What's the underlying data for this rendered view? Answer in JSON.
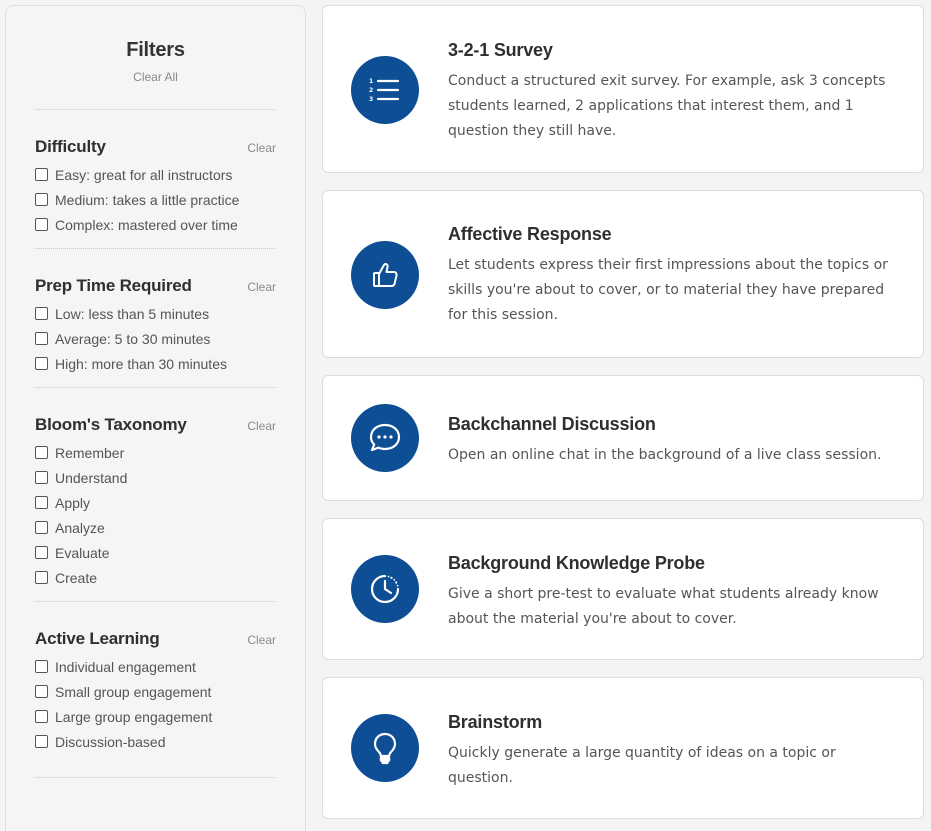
{
  "filters": {
    "title": "Filters",
    "clear_all": "Clear All",
    "groups": [
      {
        "title": "Difficulty",
        "clear": "Clear",
        "options": [
          "Easy: great for all instructors",
          "Medium: takes a little practice",
          "Complex: mastered over time"
        ]
      },
      {
        "title": "Prep Time Required",
        "clear": "Clear",
        "options": [
          "Low: less than 5 minutes",
          "Average: 5 to 30 minutes",
          "High: more than 30 minutes"
        ]
      },
      {
        "title": "Bloom's Taxonomy",
        "clear": "Clear",
        "options": [
          "Remember",
          "Understand",
          "Apply",
          "Analyze",
          "Evaluate",
          "Create"
        ]
      },
      {
        "title": "Active Learning",
        "clear": "Clear",
        "options": [
          "Individual engagement",
          "Small group engagement",
          "Large group engagement",
          "Discussion-based"
        ]
      }
    ]
  },
  "cards": [
    {
      "title": "3-2-1 Survey",
      "icon": "numbered-list-icon",
      "description": "Conduct a structured exit survey. For example, ask 3 concepts students learned, 2 applications that interest them, and 1 question they still have."
    },
    {
      "title": "Affective Response",
      "icon": "thumbs-up-icon",
      "description": "Let students express their first impressions about the topics or skills you're about to cover, or to material they have prepared for this session."
    },
    {
      "title": "Backchannel Discussion",
      "icon": "chat-bubble-icon",
      "description": "Open an online chat in the background of a live class session."
    },
    {
      "title": "Background Knowledge Probe",
      "icon": "clock-icon",
      "description": "Give a short pre-test to evaluate what students already know about the material you're about to cover."
    },
    {
      "title": "Brainstorm",
      "icon": "lightbulb-icon",
      "description": "Quickly generate a large quantity of ideas on a topic or question."
    }
  ],
  "colors": {
    "accent": "#0d4e95",
    "page_bg": "#f4f4f4",
    "sidebar_bg": "#f5f5f5"
  }
}
